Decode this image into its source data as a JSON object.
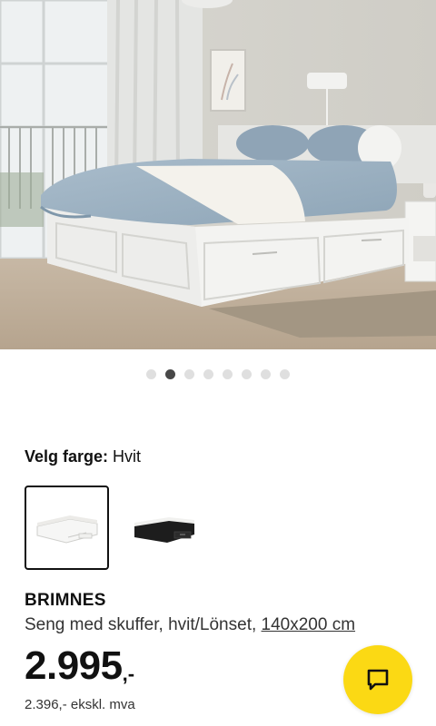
{
  "carousel": {
    "dot_count": 8,
    "active_index": 1
  },
  "color_selector": {
    "label": "Velg farge:",
    "selected": "Hvit",
    "options": [
      {
        "name": "white-variant",
        "selected": true
      },
      {
        "name": "black-variant",
        "selected": false
      }
    ]
  },
  "product": {
    "name": "BRIMNES",
    "description": "Seng med skuffer, hvit/Lönset, ",
    "size": "140x200 cm",
    "price_main": "2.995",
    "price_suffix": ",-",
    "price_ex_vat": "2.396,- ekskl. mva"
  },
  "colors": {
    "accent_yellow": "#fbd914",
    "active_dot": "#484848",
    "inactive_dot": "#dfdfdf"
  },
  "icons": {
    "chat": "chat-bubble-icon"
  }
}
